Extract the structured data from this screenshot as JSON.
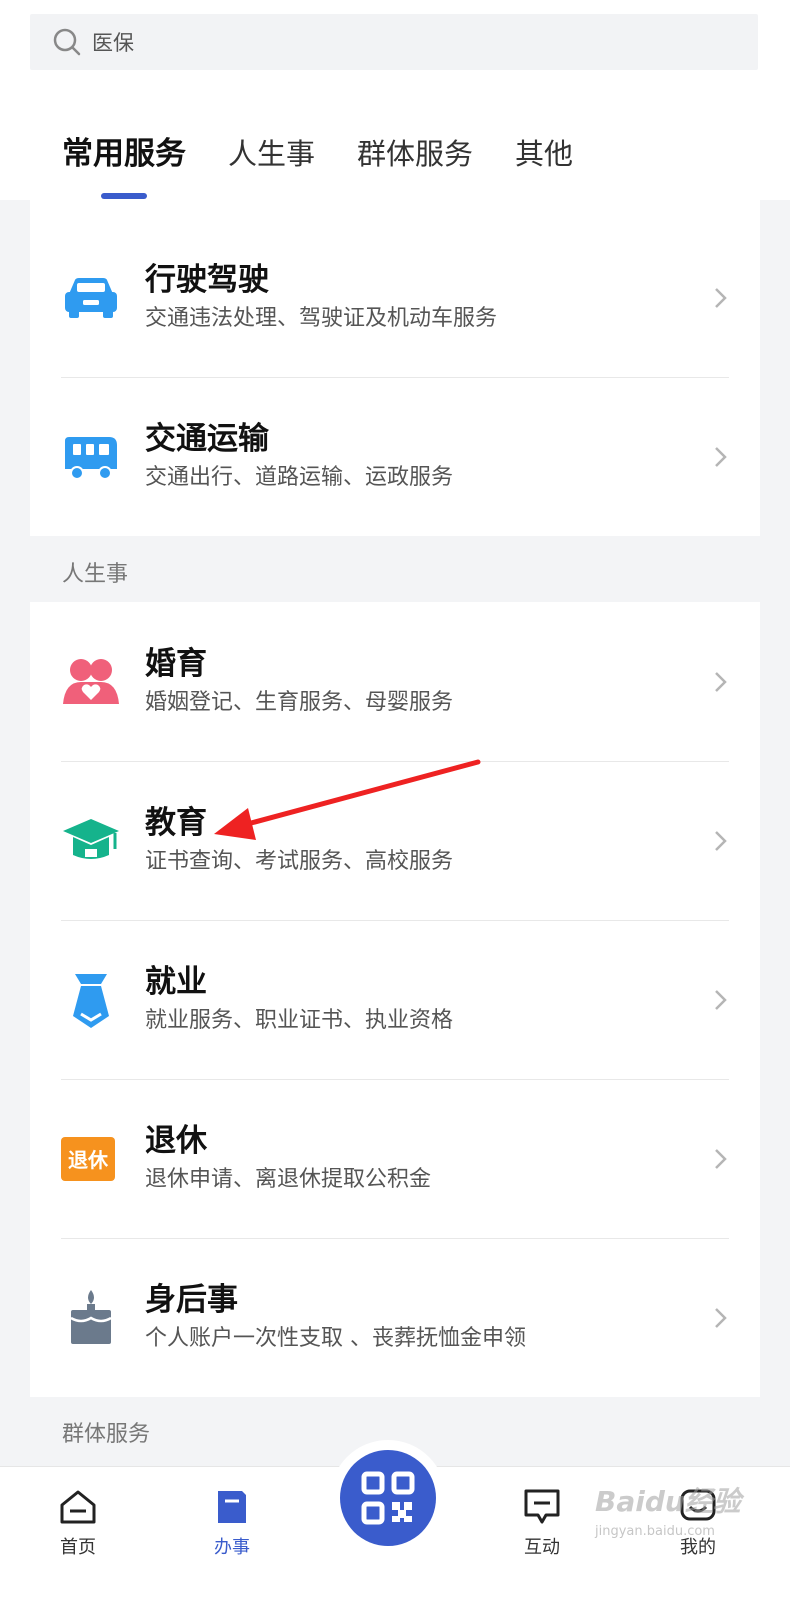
{
  "search": {
    "placeholder": "医保"
  },
  "tabs": [
    {
      "label": "常用服务",
      "active": true
    },
    {
      "label": "人生事",
      "active": false
    },
    {
      "label": "群体服务",
      "active": false
    },
    {
      "label": "其他",
      "active": false
    }
  ],
  "common": {
    "items": [
      {
        "title": "行驶驾驶",
        "sub": "交通违法处理、驾驶证及机动车服务",
        "icon": "car-icon"
      },
      {
        "title": "交通运输",
        "sub": "交通出行、道路运输、运政服务",
        "icon": "truck-icon"
      }
    ]
  },
  "life": {
    "label": "人生事",
    "items": [
      {
        "title": "婚育",
        "sub": "婚姻登记、生育服务、母婴服务",
        "icon": "heart-couple-icon"
      },
      {
        "title": "教育",
        "sub": "证书查询、考试服务、高校服务",
        "icon": "graduation-cap-icon"
      },
      {
        "title": "就业",
        "sub": "就业服务、职业证书、执业资格",
        "icon": "necktie-icon"
      },
      {
        "title": "退休",
        "sub": "退休申请、离退休提取公积金",
        "icon": "retire-badge-icon",
        "badge": "退休"
      },
      {
        "title": "身后事",
        "sub": "个人账户一次性支取 、丧葬抚恤金申领",
        "icon": "candle-icon"
      }
    ]
  },
  "group": {
    "label": "群体服务"
  },
  "bottom_nav": [
    {
      "label": "首页"
    },
    {
      "label": "办事",
      "active": true
    },
    {
      "label": "互动"
    },
    {
      "label": "我的"
    }
  ],
  "watermark": {
    "text": "Baidu经验",
    "url": "jingyan.baidu.com"
  },
  "colors": {
    "accent": "#3a5ccc",
    "car": "#2f9bf0",
    "heart": "#f0607a",
    "edu": "#15b38c",
    "retire": "#f6921e",
    "candle": "#6b7a8c",
    "arrow": "#ee2222"
  }
}
